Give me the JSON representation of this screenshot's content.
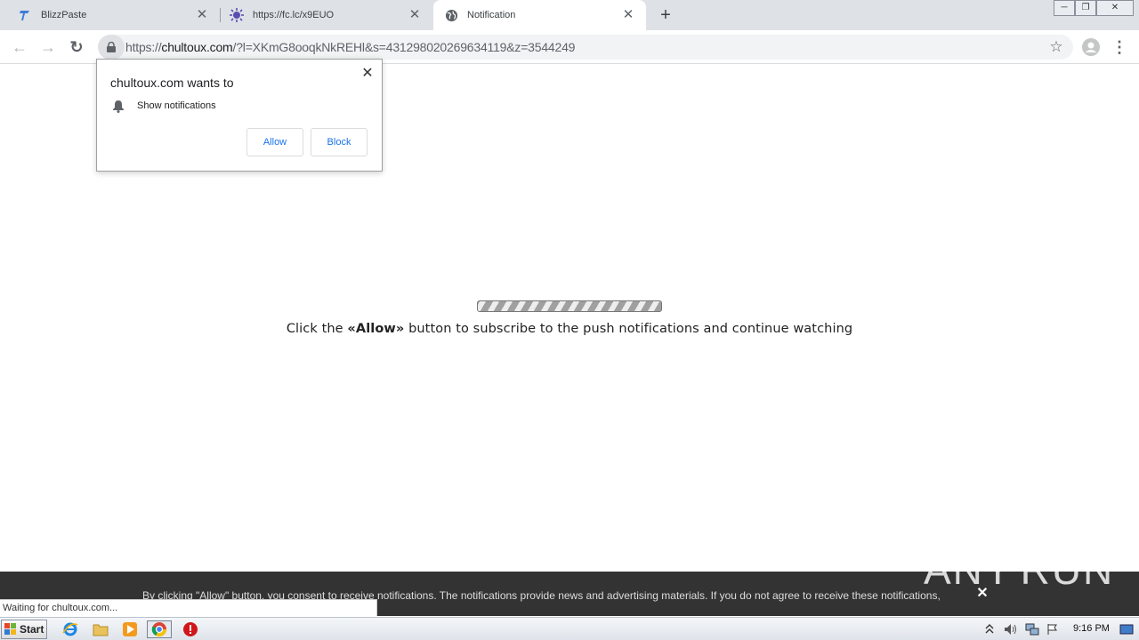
{
  "window": {
    "minimize_glyph": "─",
    "restore_glyph": "❐",
    "close_glyph": "✕"
  },
  "tabs": [
    {
      "title": "BlizzPaste",
      "favicon": "blizzpaste-icon",
      "close": "✕"
    },
    {
      "title": "https://fc.lc/x9EUO",
      "favicon": "virus-icon",
      "close": "✕"
    },
    {
      "title": "Notification",
      "favicon": "globe-icon",
      "close": "✕",
      "active": true
    }
  ],
  "new_tab_glyph": "+",
  "toolbar": {
    "back_glyph": "←",
    "forward_glyph": "→",
    "reload_glyph": "↻",
    "url_scheme": "https://",
    "url_host": "chultoux.com",
    "url_rest": "/?l=XKmG8ooqkNkREHl&s=431298020269634119&z=3544249",
    "star_glyph": "☆",
    "menu_glyph": "⋮"
  },
  "permission_prompt": {
    "title": "chultoux.com wants to",
    "permission": "Show notifications",
    "allow_label": "Allow",
    "block_label": "Block",
    "close_glyph": "✕"
  },
  "page": {
    "cta_prefix": "Click the ",
    "cta_bold": "«Allow»",
    "cta_suffix": " button to subscribe to the push notifications and continue watching"
  },
  "banner": {
    "text": "By clicking \"Allow\" button, you consent to receive notifications. The notifications provide news and advertising materials. If you do not agree to receive these notifications,",
    "close_glyph": "✕"
  },
  "watermark": {
    "left": "ANY",
    "right": "RUN"
  },
  "status_text": "Waiting for chultoux.com...",
  "taskbar": {
    "start_label": "Start",
    "clock": "9:16 PM"
  },
  "colors": {
    "tabstrip": "#dee1e6",
    "link_blue": "#1a73e8",
    "banner": "#333333"
  }
}
